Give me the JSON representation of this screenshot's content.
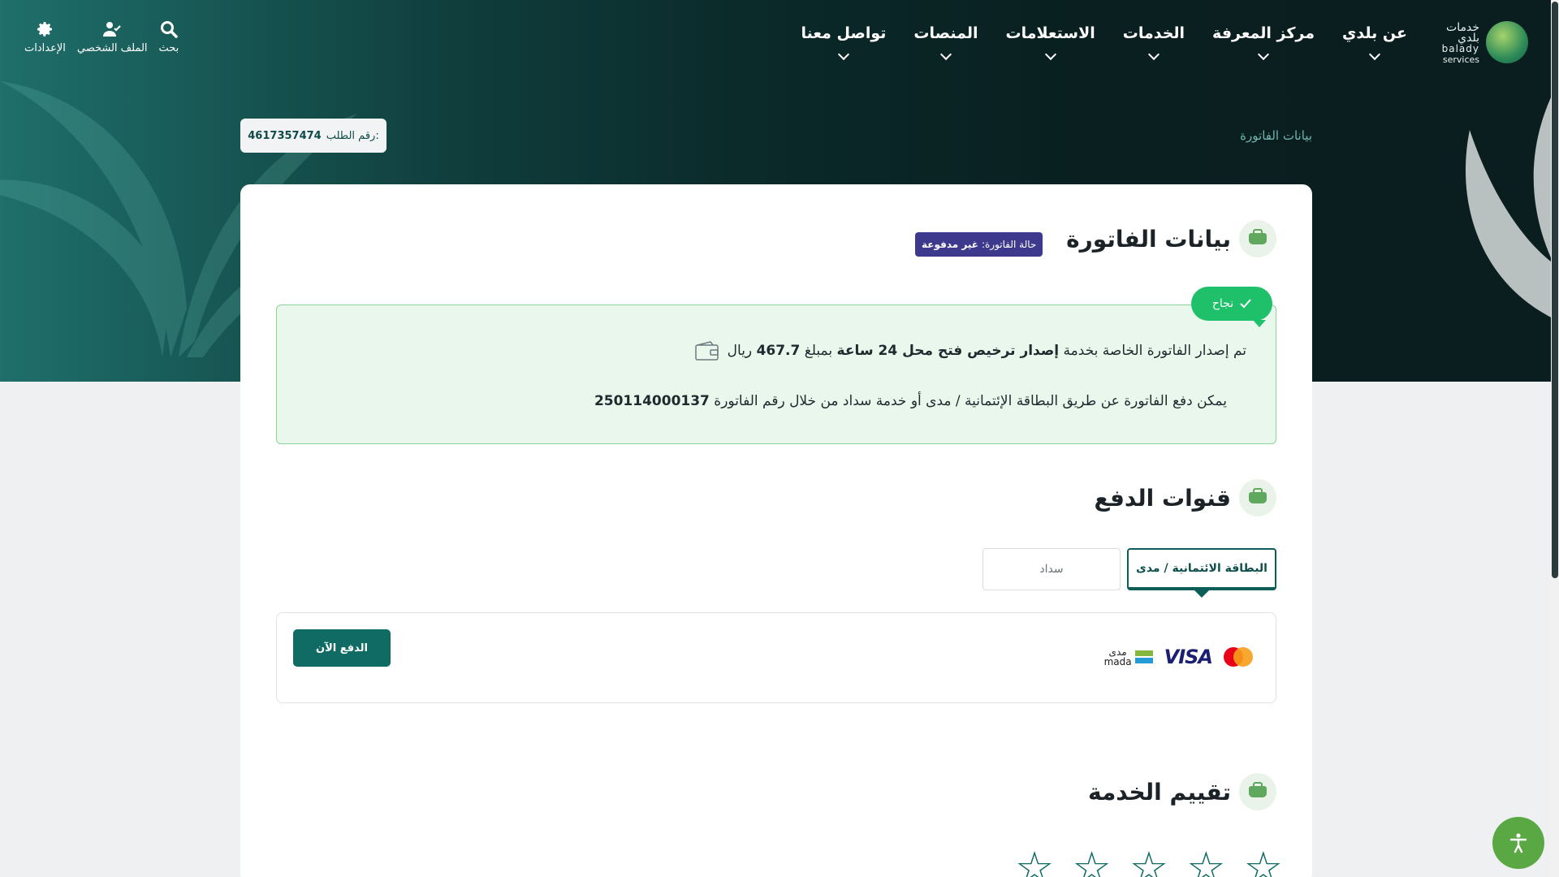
{
  "logo": {
    "ar": "خدمات بلدي",
    "en1": "balady",
    "en2": "services"
  },
  "nav": {
    "items": [
      {
        "label": "عن بلدي"
      },
      {
        "label": "مركز المعرفة"
      },
      {
        "label": "الخدمات"
      },
      {
        "label": "الاستعلامات"
      },
      {
        "label": "المنصات"
      },
      {
        "label": "تواصل معنا"
      }
    ],
    "tools": {
      "search": "بحث",
      "profile": "الملف الشخصي",
      "settings": "الإعدادات"
    }
  },
  "breadcrumb": "بيانات الفاتورة",
  "order": {
    "label": "رقم الطلب:",
    "number": "4617357474"
  },
  "invoice": {
    "title": "بيانات الفاتورة",
    "status_label": "حالة الفاتورة:",
    "status_value": "غير مدفوعة",
    "success_label": "نجاح",
    "line1_pre": "تم إصدار الفاتورة الخاصة بخدمة",
    "line1_service": "إصدار ترخيص فتح محل 24 ساعة",
    "line1_mid": "بمبلغ",
    "line1_amount": "467.7",
    "line1_currency": "ريال",
    "line2_text": "يمكن دفع الفاتورة عن طريق البطاقة الإئتمانية / مدى أو خدمة سداد من خلال رقم الفاتورة",
    "line2_number": "250114000137"
  },
  "payment": {
    "title": "قنوات الدفع",
    "tab_card": "البطاقة الائتمانية / مدى",
    "tab_sadad": "سداد",
    "pay_button": "الدفع الآن",
    "visa": "VISA",
    "mada_ar": "مدى",
    "mada_en": "mada"
  },
  "rating": {
    "title": "تقييم الخدمة",
    "stars": [
      "☆",
      "☆",
      "☆",
      "☆",
      "☆"
    ]
  },
  "colors": {
    "primary": "#0f6b64",
    "success": "#1ec06a",
    "badge": "#3d3a8e",
    "icon_green": "#5fa85d"
  }
}
